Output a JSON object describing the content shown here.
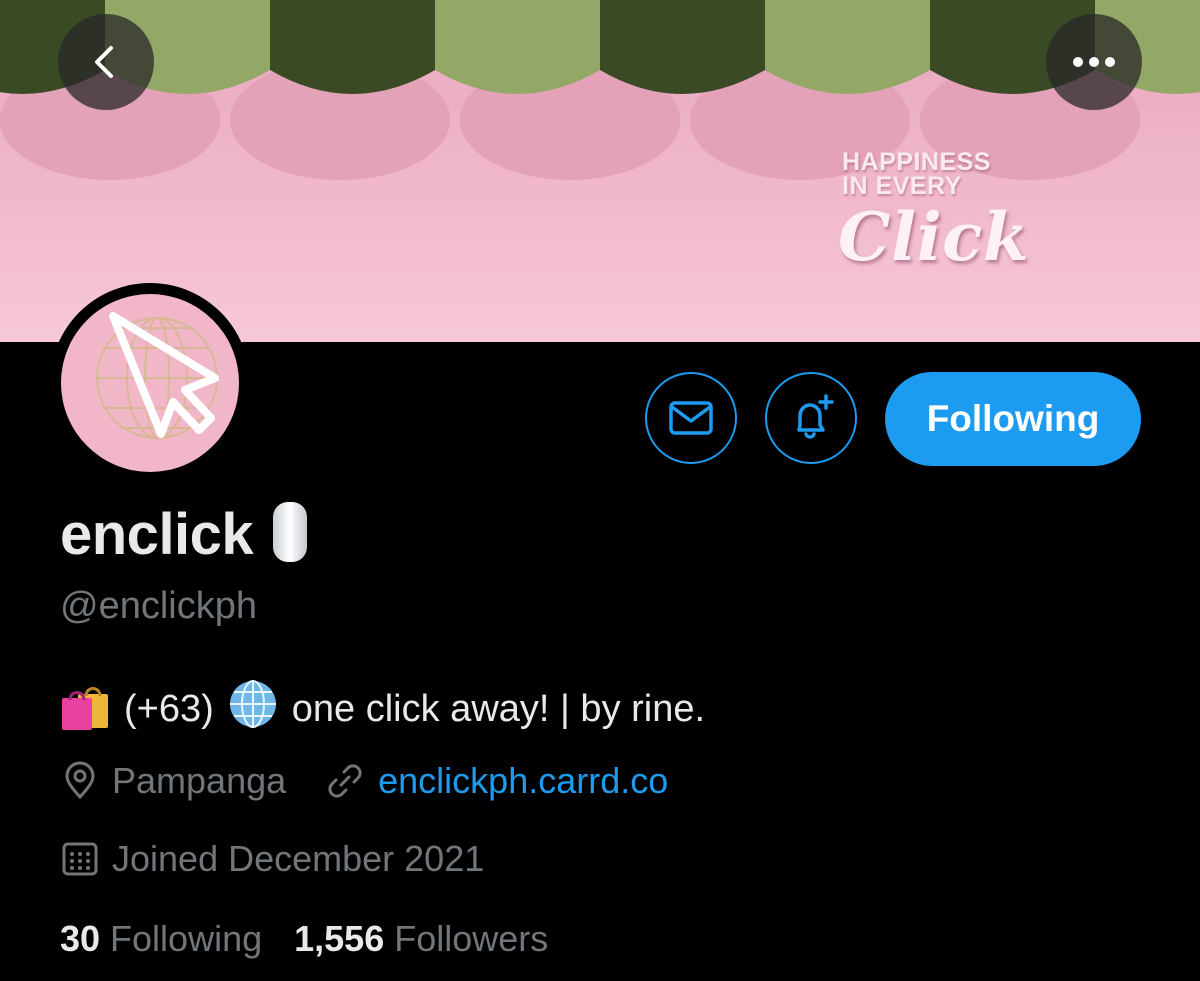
{
  "header": {
    "back_icon": "chevron-left-icon",
    "more_icon": "ellipsis-icon"
  },
  "banner": {
    "line1": "HAPPINESS",
    "line2": "IN EVERY",
    "line3": "Click",
    "colors": {
      "green_light": "#93a866",
      "green_dark": "#3a4a25",
      "pink": "#f2b6c9"
    }
  },
  "profile": {
    "display_name": "enclick",
    "handle": "@enclickph",
    "bio": {
      "part1": "(+63)",
      "part2": "one click away! | by rine."
    },
    "location": "Pampanga",
    "website": "enclickph.carrd.co",
    "joined": "Joined December 2021",
    "following_count": "30",
    "following_label": "Following",
    "followers_count": "1,556",
    "followers_label": "Followers"
  },
  "actions": {
    "message_icon": "envelope-icon",
    "notify_icon": "bell-plus-icon",
    "follow_label": "Following"
  },
  "colors": {
    "accent": "#1d9bf0",
    "muted": "#71767b",
    "text": "#e7e9ea",
    "background": "#000000"
  }
}
